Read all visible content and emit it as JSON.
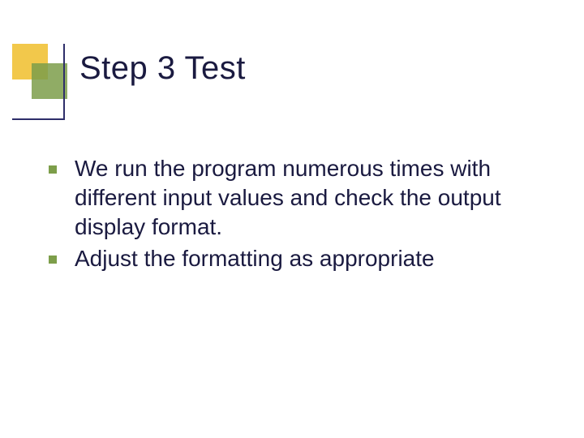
{
  "slide": {
    "title": "Step 3 Test",
    "bullets": [
      "We run the program numerous times with different input values and check the output display format.",
      "Adjust the formatting as appropriate"
    ]
  },
  "colors": {
    "accent_yellow": "#f2c84b",
    "accent_green": "#7d9e4a",
    "text": "#1a1a40"
  }
}
